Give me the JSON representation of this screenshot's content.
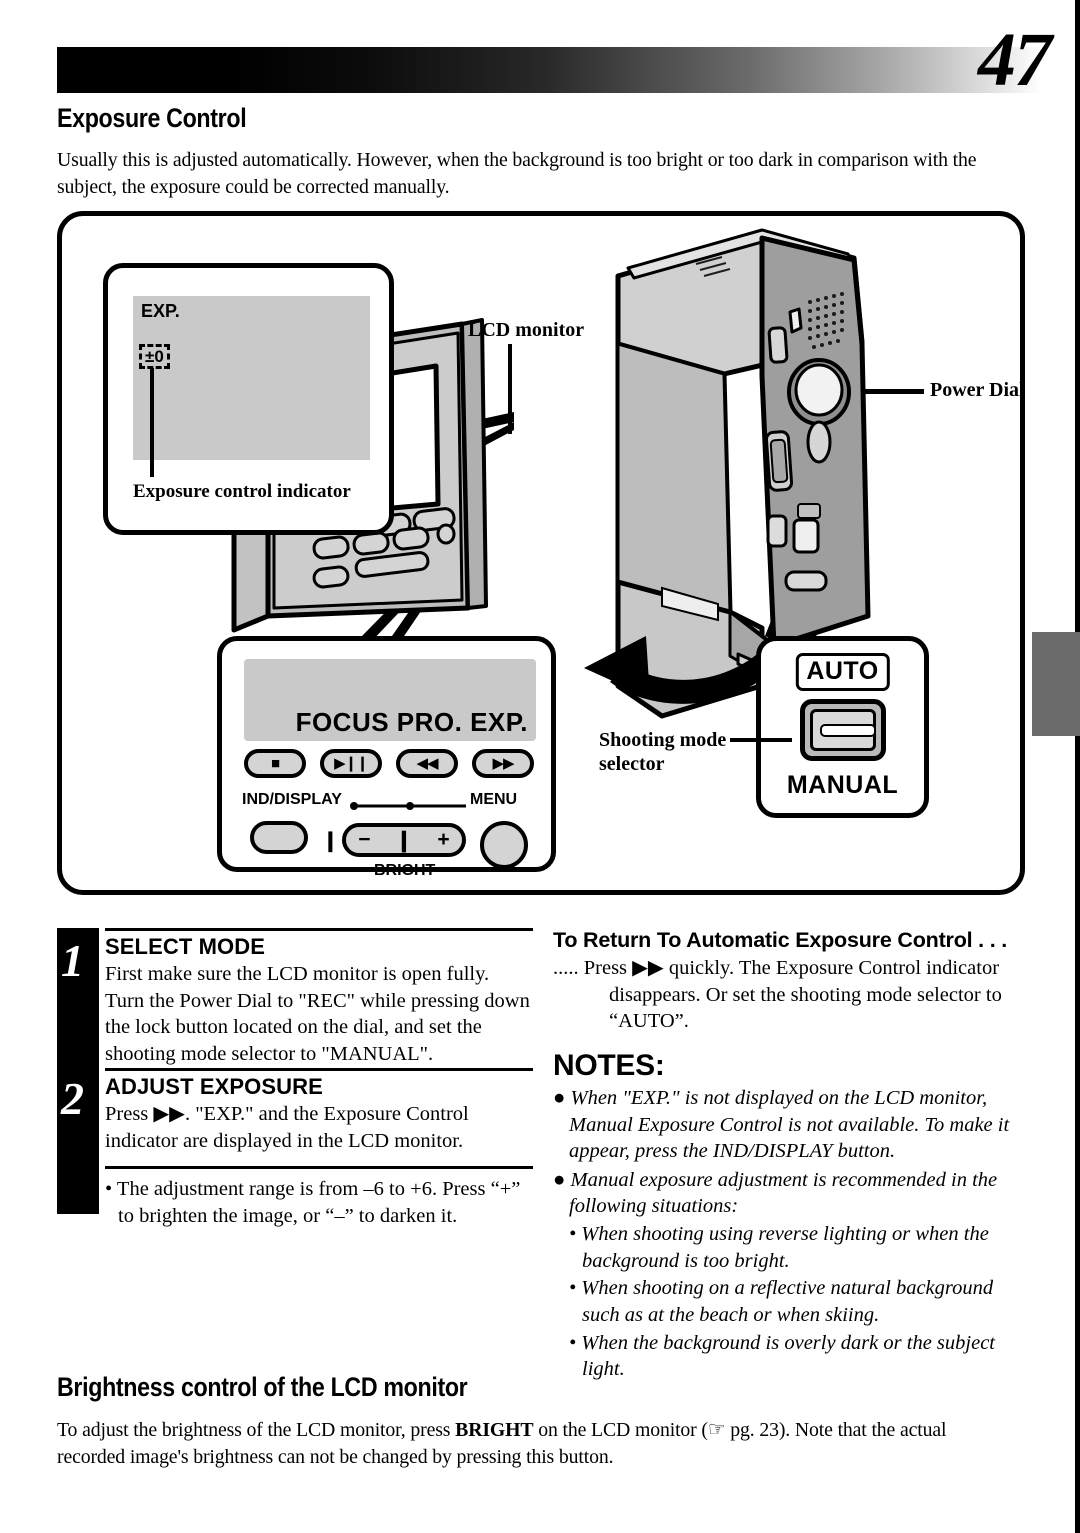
{
  "page": {
    "number": "47"
  },
  "section": {
    "title": "Exposure Control",
    "intro": "Usually this is adjusted automatically. However, when the background is too bright or too dark in comparison with the subject, the exposure could be corrected manually."
  },
  "illustration": {
    "monitor_callout": {
      "screen_text": "EXP.",
      "indicator_value": "±0",
      "caption": "Exposure control indicator"
    },
    "labels": {
      "lcd_monitor": "LCD monitor",
      "power_dial": "Power Dial",
      "shooting_mode_selector_line1": "Shooting mode",
      "shooting_mode_selector_line2": "selector"
    },
    "control_panel": {
      "screen_text": "FOCUS PRO.  EXP.",
      "buttons": [
        {
          "name": "stop-button",
          "glyph": "■"
        },
        {
          "name": "play-pause-button",
          "glyph": "▶❙❙"
        },
        {
          "name": "rewind-button",
          "glyph": "◀◀"
        },
        {
          "name": "fast-forward-button",
          "glyph": "▶▶"
        }
      ],
      "ind_display_label": "IND/DISPLAY",
      "menu_label": "MENU",
      "bright_label": "BRIGHT",
      "bright_minus": "−",
      "bright_bar": "❙",
      "bright_plus": "+",
      "power_tick": "❙"
    },
    "mode_selector": {
      "auto_label": "AUTO",
      "manual_label": "MANUAL"
    }
  },
  "steps": [
    {
      "number": "1",
      "title": "SELECT MODE",
      "text": "First make sure the LCD monitor is open fully. Turn the Power Dial to \"REC\" while pressing down the lock button located on the dial, and set the shooting mode selector to \"MANUAL\"."
    },
    {
      "number": "2",
      "title": "ADJUST EXPOSURE",
      "text": "Press ▶▶. \"EXP.\" and the Exposure Control indicator are displayed in the LCD monitor."
    }
  ],
  "step_bullet": "• The adjustment range is from –6 to +6. Press “+” to brighten the image, or “–” to darken it.",
  "return_section": {
    "heading": "To Return To Automatic Exposure Control . . .",
    "text": "..... Press ▶▶ quickly. The Exposure Control indicator disappears. Or set the shooting mode selector to “AUTO”."
  },
  "notes": {
    "heading": "NOTES:",
    "items": [
      "● When \"EXP.\" is not displayed on the LCD monitor, Manual Exposure Control is not available. To make it appear, press the IND/DISPLAY button.",
      "● Manual exposure adjustment is recommended in the following situations:"
    ],
    "sub_items": [
      "• When shooting using reverse lighting or when the background is too bright.",
      "• When shooting on a reflective natural background such as at the beach or when skiing.",
      "• When the background is overly dark or the subject light."
    ]
  },
  "brightness_section": {
    "title": "Brightness control of the LCD monitor",
    "text_before": "To adjust the brightness of the LCD monitor, press ",
    "text_bold": "BRIGHT",
    "text_mid": " on the LCD monitor (",
    "ref_icon": "☞",
    "ref_page": " pg. 23",
    "text_after": "). Note that the actual recorded image's brightness can not be changed by pressing this button."
  },
  "colors": {
    "ink": "#000000",
    "lcd_gray": "#c9c9c9",
    "body_gray": "#b5b5b5",
    "tab_gray": "#6b6b6b"
  }
}
